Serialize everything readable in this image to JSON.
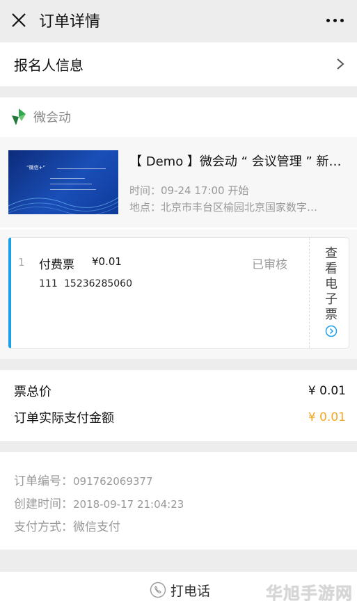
{
  "topbar": {
    "title": "订单详情"
  },
  "registrant": {
    "label": "报名人信息"
  },
  "brand": {
    "name": "微会动"
  },
  "event": {
    "title": "【 Demo 】微会动 “ 会议管理 ” 新…",
    "time_label": "时间：",
    "time_value": "09-24 17:00 开始",
    "place_label": "地点：",
    "place_value": "北京市丰台区榆园北京国家数字…",
    "thumb_title": "“微信+”"
  },
  "ticket": {
    "index": "1",
    "name": "付费票",
    "price": "¥0.01",
    "status": "已审核",
    "holder": "111",
    "phone": "15236285060",
    "eticket_label": "查看电子票"
  },
  "totals": {
    "total_label": "票总价",
    "total_value": "¥ 0.01",
    "paid_label": "订单实际支付金额",
    "paid_value": "¥ 0.01"
  },
  "meta": {
    "order_no_label": "订单编号：",
    "order_no_value": "091762069377",
    "created_label": "创建时间：",
    "created_value": "2018-09-17 21:04:23",
    "pay_label": "支付方式：",
    "pay_value": "微信支付"
  },
  "bottom": {
    "call_label": "打电话"
  },
  "watermark": "华旭手游网",
  "colors": {
    "accent_blue": "#1aa0e6",
    "orange": "#f5a623",
    "brand_green": "#2fa84f"
  }
}
